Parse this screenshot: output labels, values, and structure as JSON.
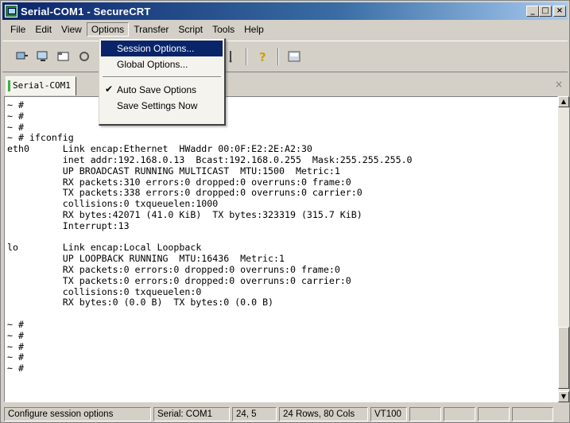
{
  "window": {
    "title": "Serial-COM1 - SecureCRT",
    "buttons": {
      "minimize": "_",
      "maximize": "□",
      "close": "×"
    }
  },
  "menubar": {
    "items": [
      {
        "label": "File"
      },
      {
        "label": "Edit"
      },
      {
        "label": "View"
      },
      {
        "label": "Options"
      },
      {
        "label": "Transfer"
      },
      {
        "label": "Script"
      },
      {
        "label": "Tools"
      },
      {
        "label": "Help"
      }
    ]
  },
  "toolbar": {
    "icons": [
      "connect-icon",
      "quick-connect-icon",
      "connect-tab-icon",
      "reconnect-icon",
      "copy-icon",
      "paste-icon",
      "print-icon",
      "session-options-icon",
      "settings-icon",
      "keymap-icon",
      "help-icon",
      "sftp-icon"
    ]
  },
  "options_menu": {
    "session_options": "Session Options...",
    "global_options": "Global Options...",
    "auto_save_options": "Auto Save Options",
    "auto_save_checked": "✔",
    "save_settings_now": "Save Settings Now"
  },
  "tabs": {
    "active": "Serial-COM1",
    "close_glyph": "×"
  },
  "terminal": {
    "lines": [
      "~ #",
      "~ #",
      "~ #",
      "~ # ifconfig",
      "eth0      Link encap:Ethernet  HWaddr 00:0F:E2:2E:A2:30",
      "          inet addr:192.168.0.13  Bcast:192.168.0.255  Mask:255.255.255.0",
      "          UP BROADCAST RUNNING MULTICAST  MTU:1500  Metric:1",
      "          RX packets:310 errors:0 dropped:0 overruns:0 frame:0",
      "          TX packets:338 errors:0 dropped:0 overruns:0 carrier:0",
      "          collisions:0 txqueuelen:1000",
      "          RX bytes:42071 (41.0 KiB)  TX bytes:323319 (315.7 KiB)",
      "          Interrupt:13",
      "",
      "lo        Link encap:Local Loopback",
      "          UP LOOPBACK RUNNING  MTU:16436  Metric:1",
      "          RX packets:0 errors:0 dropped:0 overruns:0 frame:0",
      "          TX packets:0 errors:0 dropped:0 overruns:0 carrier:0",
      "          collisions:0 txqueuelen:0",
      "          RX bytes:0 (0.0 B)  TX bytes:0 (0.0 B)",
      "",
      "~ #",
      "~ #",
      "~ #",
      "~ #",
      "~ #"
    ]
  },
  "statusbar": {
    "message": "Configure session options",
    "connection": "Serial: COM1",
    "cursor": "24,  5",
    "size": "24 Rows, 80 Cols",
    "emulation": "VT100"
  }
}
